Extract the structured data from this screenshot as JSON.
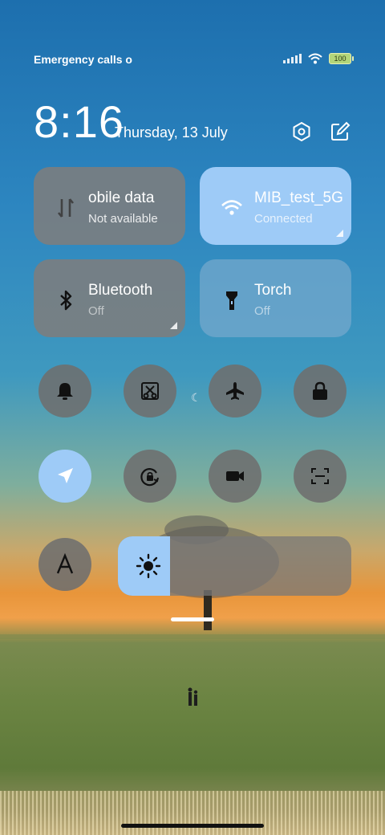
{
  "status_bar": {
    "carrier_text": "Emergency calls o",
    "battery": "100"
  },
  "header": {
    "time": "8:16",
    "date": "Thursday, 13 July"
  },
  "tiles": {
    "mobile_data": {
      "name": "obile data",
      "status": "Not available"
    },
    "wifi": {
      "name": "MIB_test_5G",
      "status": "Connected"
    },
    "bluetooth": {
      "name": "Bluetooth",
      "status": "Off"
    },
    "torch": {
      "name": "Torch",
      "status": "Off"
    }
  },
  "toggles": {
    "row1": [
      "bell-icon",
      "screenshot-icon",
      "airplane-icon",
      "lock-icon"
    ],
    "row2": [
      "location-icon",
      "rotation-lock-icon",
      "video-icon",
      "scan-icon"
    ],
    "row3": [
      "font-icon"
    ]
  },
  "brightness": {
    "level_fraction": 0.22
  },
  "colors": {
    "accent": "#9ecbf7",
    "tile_gray": "#7d7d7d"
  }
}
